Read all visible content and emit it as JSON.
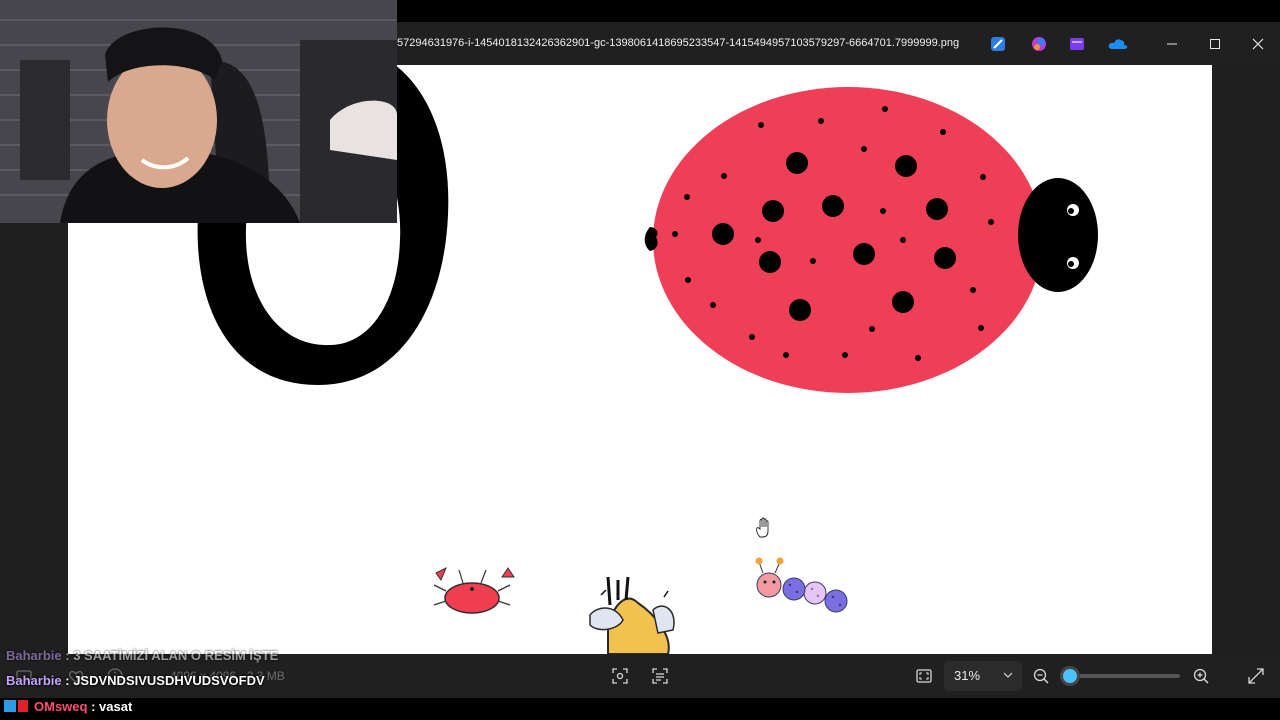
{
  "window": {
    "title": "57294631976-i-1454018132426362901-gc-1398061418695233547-1415494957103579297-6664701.7999999.png",
    "app_icons": [
      "designer-icon",
      "copilot-icon",
      "clipchamp-icon",
      "onedrive-icon"
    ],
    "controls": [
      "minimize-icon",
      "maximize-icon",
      "close-icon"
    ]
  },
  "toolbar": {
    "info": "4096 x 4096 · 2.3 MB",
    "zoom_level": "31%",
    "zoom_fraction": 0.05,
    "icons": [
      "show-picture-icon",
      "heart-icon",
      "info-icon",
      "select-area-icon",
      "ocr-scan-icon",
      "fit-window-icon",
      "zoom-out-icon",
      "zoom-in-icon",
      "full-screen-icon"
    ]
  },
  "chat": [
    {
      "user": "Baharbie",
      "sep": " : ",
      "text": "3 SAATİMİZİ ALAN O RESİM İŞTE"
    },
    {
      "user": "Baharbie",
      "sep": " : ",
      "text": "JSDVNDSIVUSDHVUDSVOFDV"
    },
    {
      "user": "OMsweq",
      "sep": " : ",
      "text": "vasat"
    }
  ],
  "colors": {
    "ladybug_body": "#ef3f57",
    "crab": "#ee3e4f",
    "accent": "#4cc2ff"
  }
}
